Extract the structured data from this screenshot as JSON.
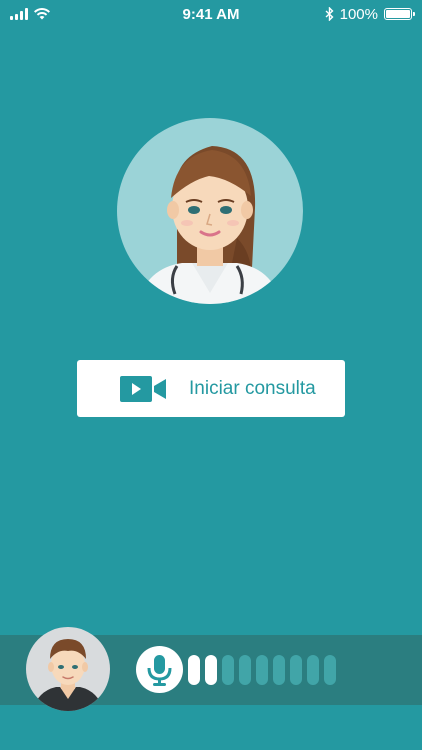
{
  "status_bar": {
    "time": "9:41 AM",
    "battery_percent": "100%",
    "icons": [
      "signal-icon",
      "wifi-icon",
      "bluetooth-icon",
      "battery-icon"
    ]
  },
  "doctor": {
    "avatar_icon": "doctor-avatar"
  },
  "consult_button": {
    "label": "Iniciar consulta",
    "icon": "video-camera-icon"
  },
  "call_bar": {
    "user_avatar_icon": "user-avatar",
    "mic_icon": "microphone-icon",
    "audio_level_bars": 9,
    "audio_level_active": 2
  },
  "colors": {
    "background": "#2499a1",
    "call_bar": "#2b7e80",
    "accent": "#2499a1",
    "level_inactive": "#41a5a8",
    "white": "#ffffff"
  }
}
